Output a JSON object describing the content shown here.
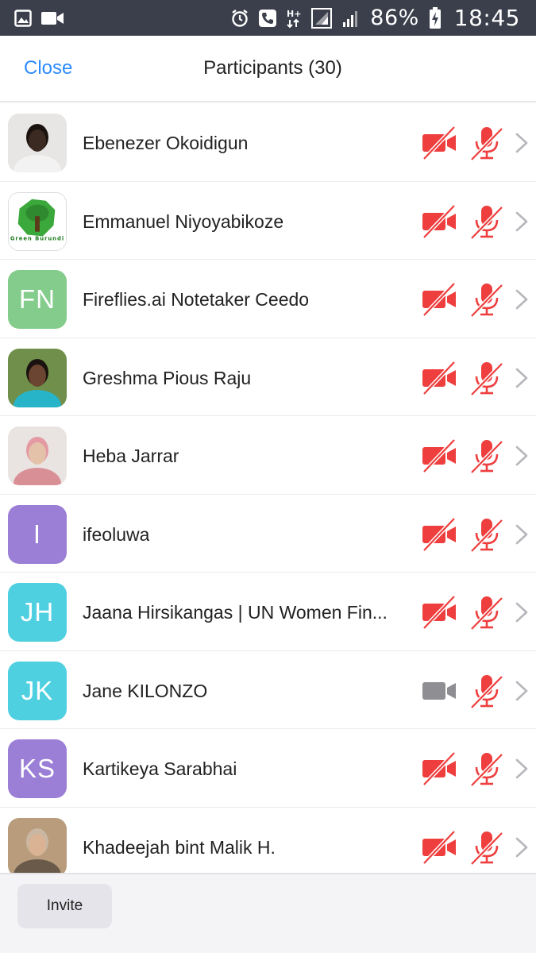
{
  "status_bar": {
    "battery": "86%",
    "time": "18:45",
    "network_type": "H+"
  },
  "header": {
    "close_label": "Close",
    "title": "Participants (30)"
  },
  "participants": [
    {
      "name": "Ebenezer Okoidigun",
      "avatar_type": "photo",
      "avatar_icon": "person-photo",
      "video_muted": true,
      "audio_muted": true
    },
    {
      "name": "Emmanuel Niyoyabikoze",
      "avatar_type": "logo",
      "avatar_icon": "green-burundi-logo",
      "logo_text": "Green Burundi",
      "video_muted": true,
      "audio_muted": true
    },
    {
      "name": "Fireflies.ai Notetaker Ceedo",
      "avatar_type": "initials",
      "initials": "FN",
      "avatar_color": "#84cc8c",
      "video_muted": true,
      "audio_muted": true
    },
    {
      "name": "Greshma Pious Raju",
      "avatar_type": "photo",
      "avatar_icon": "person-photo",
      "video_muted": true,
      "audio_muted": true
    },
    {
      "name": "Heba Jarrar",
      "avatar_type": "photo",
      "avatar_icon": "person-photo",
      "video_muted": true,
      "audio_muted": true
    },
    {
      "name": "ifeoluwa",
      "avatar_type": "initials",
      "initials": "I",
      "avatar_color": "#9b7fd6",
      "video_muted": true,
      "audio_muted": true
    },
    {
      "name": "Jaana Hirsikangas | UN Women Fin...",
      "avatar_type": "initials",
      "initials": "JH",
      "avatar_color": "#4fd0e0",
      "video_muted": true,
      "audio_muted": true
    },
    {
      "name": "Jane KILONZO",
      "avatar_type": "initials",
      "initials": "JK",
      "avatar_color": "#4fd0e0",
      "video_muted": false,
      "audio_muted": true
    },
    {
      "name": "Kartikeya Sarabhai",
      "avatar_type": "initials",
      "initials": "KS",
      "avatar_color": "#9b7fd6",
      "video_muted": true,
      "audio_muted": true
    },
    {
      "name": "Khadeejah bint Malik H.",
      "avatar_type": "photo",
      "avatar_icon": "person-photo",
      "video_muted": true,
      "audio_muted": true
    }
  ],
  "footer": {
    "invite_label": "Invite"
  },
  "colors": {
    "accent": "#2d8cff",
    "muted_red": "#ee3e3e",
    "video_on_gray": "#8e8e93",
    "status_bar_bg": "#3a3f4b"
  }
}
